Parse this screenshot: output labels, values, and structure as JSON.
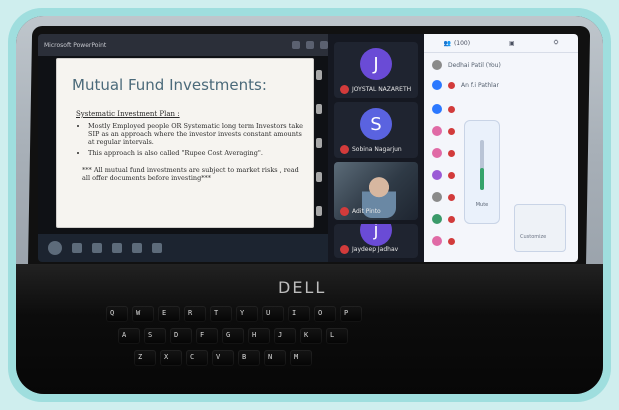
{
  "slide": {
    "title": "Mutual Fund Investments:",
    "subtitle": "Systematic Investment Plan :",
    "bullets": [
      "Mostly Employed people OR Systematic long term Investors take SIP as an approach where the investor invests constant amounts at regular intervals.",
      "This approach is also called \"Rupee Cost Averaging\"."
    ],
    "note": "*** All mutual fund investments are subject to market risks , read all offer documents before investing***"
  },
  "video": {
    "tiles": [
      {
        "initial": "J",
        "name": "JOYSTAL NAZARETH",
        "color": "#6a4bd6"
      },
      {
        "initial": "S",
        "name": "Sobina Nagarjun",
        "color": "#5a63e0"
      },
      {
        "initial": "",
        "name": "Adit Pinto",
        "color": "#3a4a5a"
      },
      {
        "initial": "j",
        "name": "Jaydeep Jadhav",
        "color": "#6a4bd6"
      }
    ]
  },
  "sidebar": {
    "tabs": [
      {
        "label": "(100)"
      }
    ],
    "entries": [
      {
        "text": "Dedhai Patil (You)",
        "color": "#8a8a8a"
      },
      {
        "text": "An f.i Pathlar",
        "color": "#2b78ff"
      }
    ],
    "pop": {
      "label": "Mute",
      "level": 0.45
    },
    "pop2": {
      "label": "Customize"
    }
  },
  "laptop": {
    "brand": "DELL",
    "keys": [
      "Q",
      "W",
      "E",
      "R",
      "T",
      "Y",
      "U",
      "I",
      "O",
      "P",
      "A",
      "S",
      "D",
      "F",
      "G",
      "H",
      "J",
      "K",
      "L",
      "Z",
      "X",
      "C",
      "V",
      "B",
      "N",
      "M"
    ]
  }
}
